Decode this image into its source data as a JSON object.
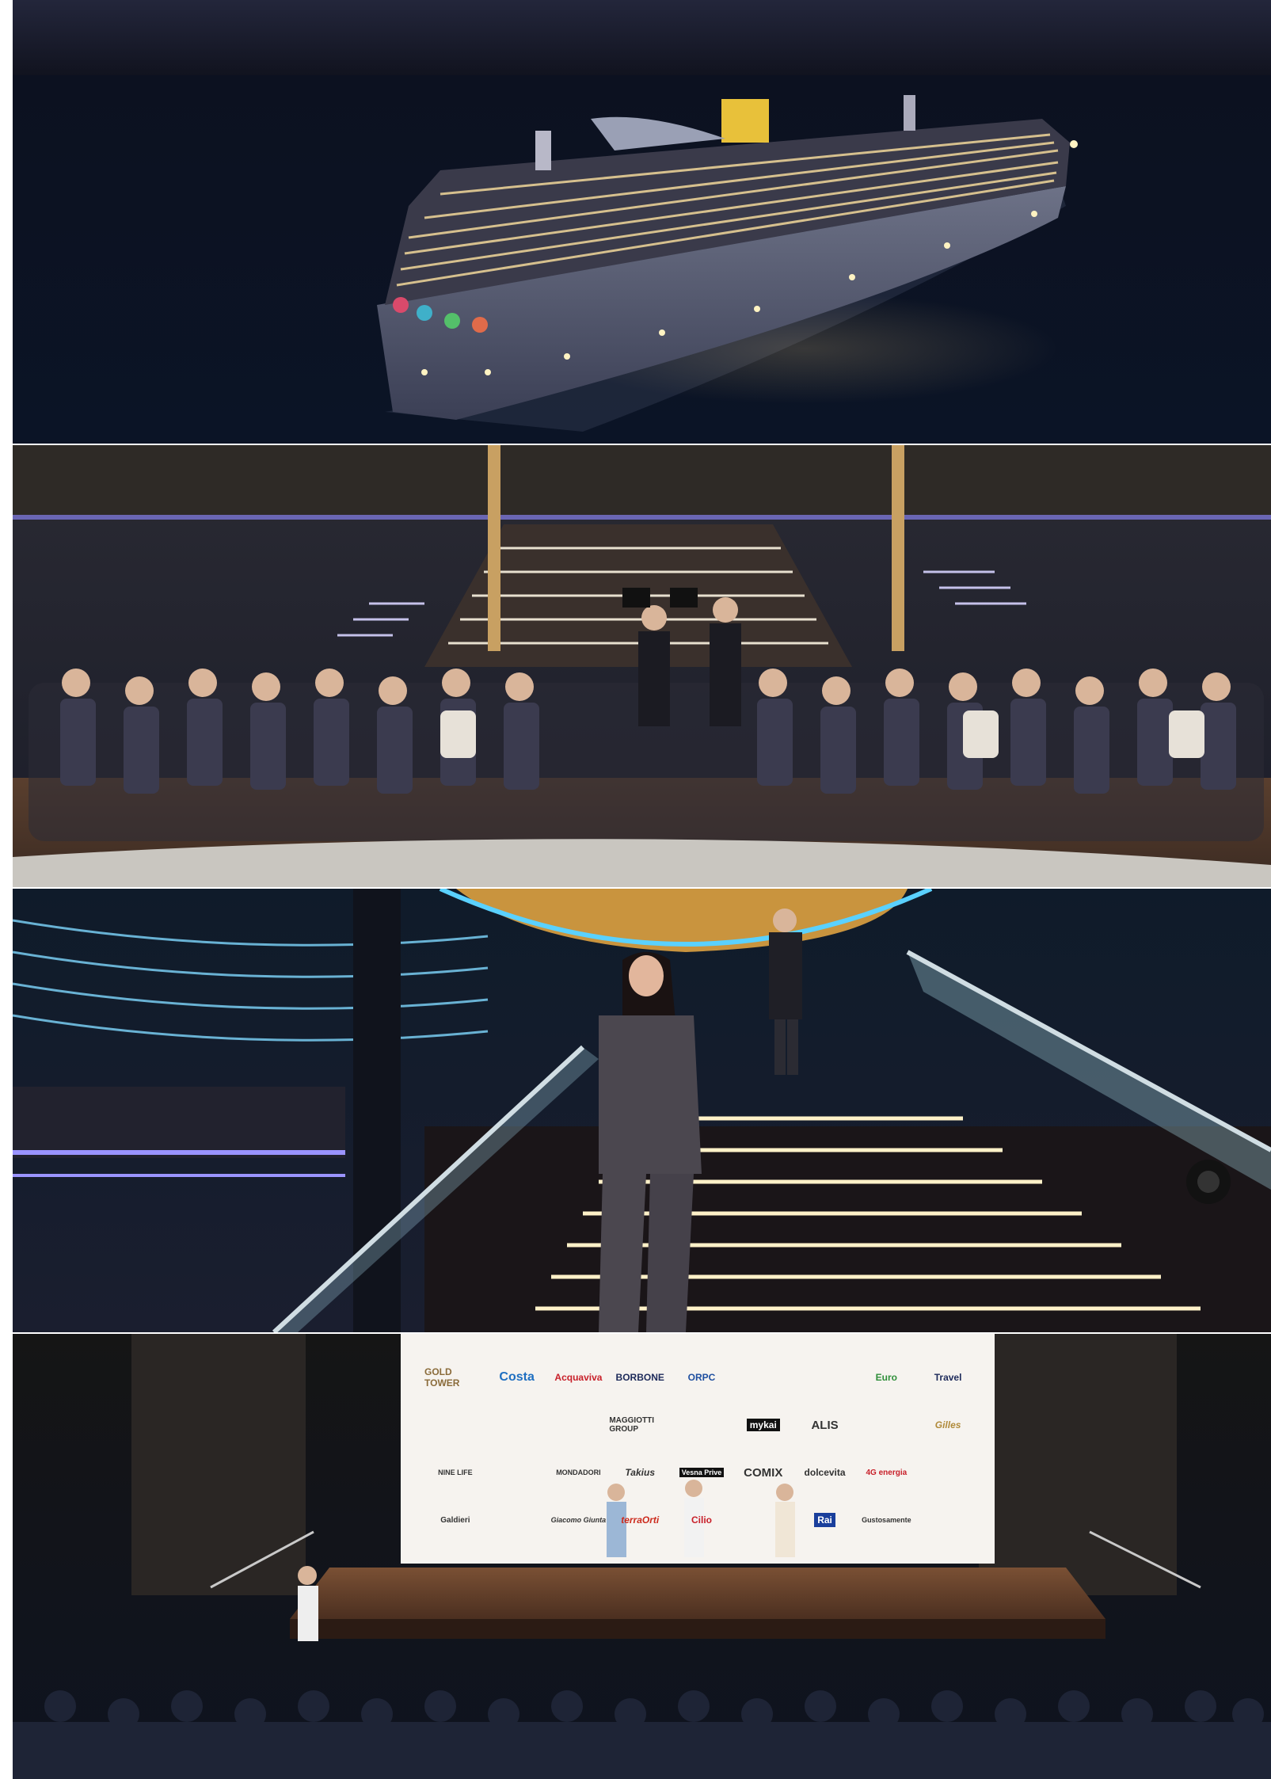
{
  "photos": [
    {
      "name": "cruise-ship-at-night"
    },
    {
      "name": "audience-seated-before-illuminated-staircase"
    },
    {
      "name": "woman-descending-lit-staircase"
    },
    {
      "name": "stage-with-sponsor-wall-and-audience"
    }
  ],
  "sponsor_wall": {
    "logos_row1": [
      "GOLD TOWER",
      "Costa",
      "Acquaviva",
      "BORBONE",
      "ORPC",
      "",
      "",
      "Euro",
      "Travel"
    ],
    "logos_row2": [
      "",
      "",
      "",
      "MAGGIOTTI GROUP",
      "",
      "mykai",
      "ALIS",
      "",
      "Gilles"
    ],
    "logos_row3": [
      "NINE LIFE",
      "",
      "MONDADORI",
      "Takius",
      "Vesna Prive",
      "COMIX",
      "dolcevita",
      "4G energia",
      ""
    ],
    "logos_row4": [
      "Galdieri",
      "",
      "Giacomo Giunta",
      "terraOrti",
      "Cilio",
      "",
      "Rai",
      "Gustosamente",
      ""
    ],
    "colors": {
      "costa_blue": "#1f6fc1",
      "acquaviva_red": "#c8202a",
      "rai_blue": "#1a3f9c",
      "terraorti_red": "#cc2a1c"
    }
  }
}
